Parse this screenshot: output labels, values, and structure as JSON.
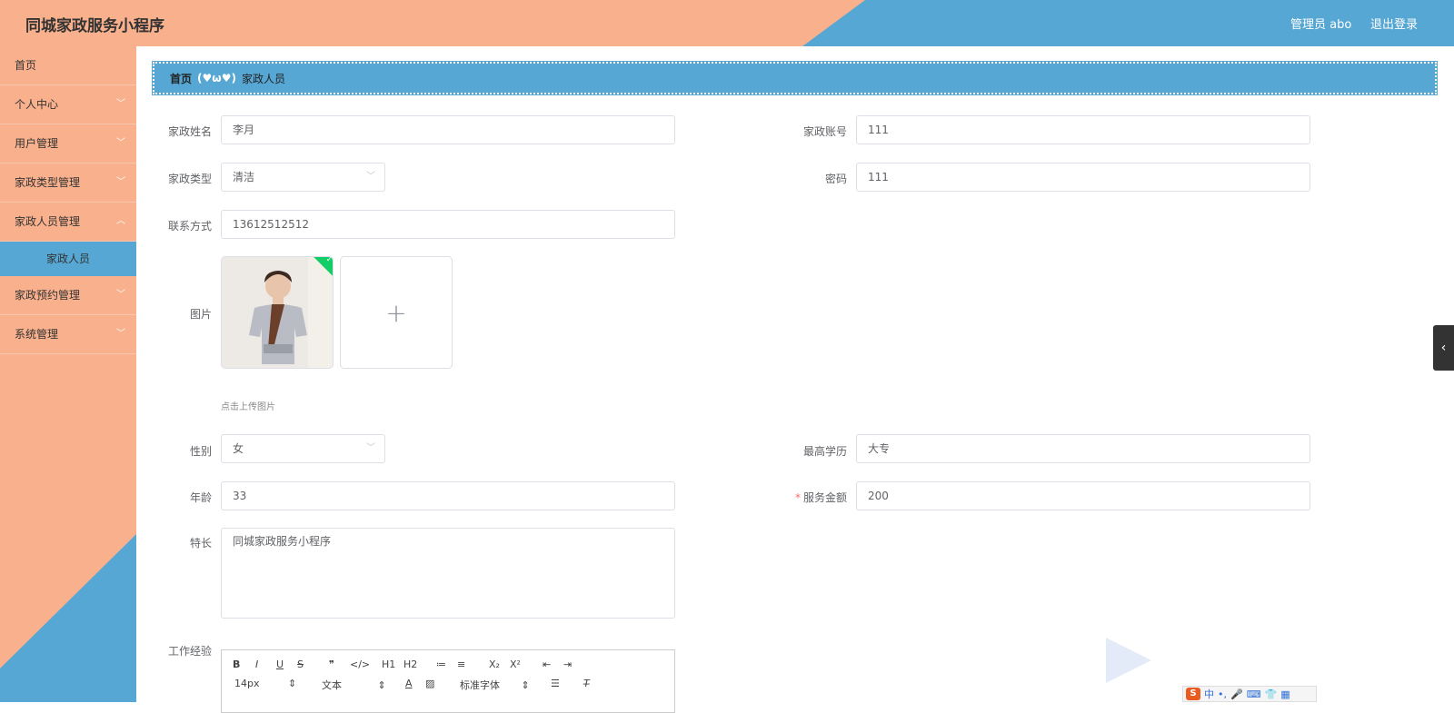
{
  "header": {
    "title": "同城家政服务小程序",
    "user": "管理员 abo",
    "logout": "退出登录"
  },
  "sidebar": {
    "items": [
      {
        "label": "首页"
      },
      {
        "label": "个人中心"
      },
      {
        "label": "用户管理"
      },
      {
        "label": "家政类型管理"
      },
      {
        "label": "家政人员管理",
        "sub": "家政人员"
      },
      {
        "label": "家政预约管理"
      },
      {
        "label": "系统管理"
      }
    ]
  },
  "breadcrumb": {
    "home": "首页",
    "separator": "(♥ω♥)",
    "current": "家政人员"
  },
  "form": {
    "name_label": "家政姓名",
    "name_value": "李月",
    "account_label": "家政账号",
    "account_value": "111",
    "type_label": "家政类型",
    "type_value": "清洁",
    "password_label": "密码",
    "password_value": "111",
    "phone_label": "联系方式",
    "phone_value": "13612512512",
    "image_label": "图片",
    "upload_tip": "点击上传图片",
    "gender_label": "性别",
    "gender_value": "女",
    "education_label": "最高学历",
    "education_value": "大专",
    "age_label": "年龄",
    "age_value": "33",
    "price_label": "服务金额",
    "price_required": "*",
    "price_value": "200",
    "specialty_label": "特长",
    "specialty_value": "同城家政服务小程序",
    "experience_label": "工作经验"
  },
  "editor": {
    "font_size": "14px",
    "heading": "文本",
    "font_family": "标准字体",
    "buttons": [
      "B",
      "I",
      "U",
      "S",
      "❞",
      "</>",
      "H1",
      "H2",
      "≔",
      "≡",
      "X₂",
      "X²",
      "⇤",
      "⇥"
    ]
  },
  "ime": {
    "labels": [
      "中",
      "•,",
      "🎤",
      "⌨",
      "👕",
      "▦"
    ]
  },
  "colors": {
    "header_orange": "#f9b08c",
    "accent_blue": "#56a7d3",
    "required_red": "#f56c6c",
    "success_green": "#13ce66"
  }
}
